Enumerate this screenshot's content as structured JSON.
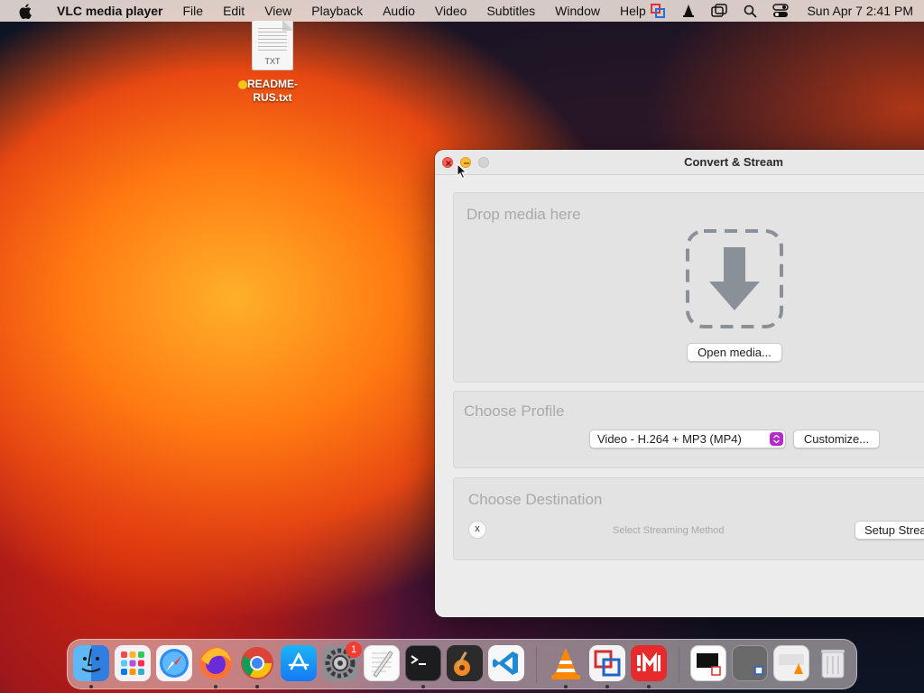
{
  "menubar": {
    "app_name": "VLC media player",
    "items": [
      "File",
      "Edit",
      "View",
      "Playback",
      "Audio",
      "Video",
      "Subtitles",
      "Window",
      "Help"
    ],
    "clock": "Sun Apr 7  2:41 PM"
  },
  "desktop": {
    "file_ext": "TXT",
    "file_name_line1": "README-",
    "file_name_line2": "RUS.txt"
  },
  "window": {
    "title": "Convert & Stream",
    "drop": {
      "title": "Drop media here",
      "open_button": "Open media..."
    },
    "profile": {
      "title": "Choose Profile",
      "selected": "Video - H.264 + MP3 (MP4)",
      "customize_button": "Customize..."
    },
    "destination": {
      "title": "Choose Destination",
      "clear_button": "x",
      "method_label": "Select Streaming Method",
      "setup_button": "Setup Streaming..."
    }
  },
  "dock": {
    "apps": [
      "Finder",
      "Launchpad",
      "Safari",
      "Firefox",
      "Chrome",
      "App Store",
      "System Settings",
      "TextEdit",
      "Terminal",
      "GarageBand",
      "VS Code",
      "VLC",
      "Parallels",
      "Parallels Toolbox"
    ],
    "system_settings_badge": "1"
  },
  "colors": {
    "close": "#fe5f57",
    "minimize": "#febc2e",
    "select_accent": "#b52acb"
  }
}
